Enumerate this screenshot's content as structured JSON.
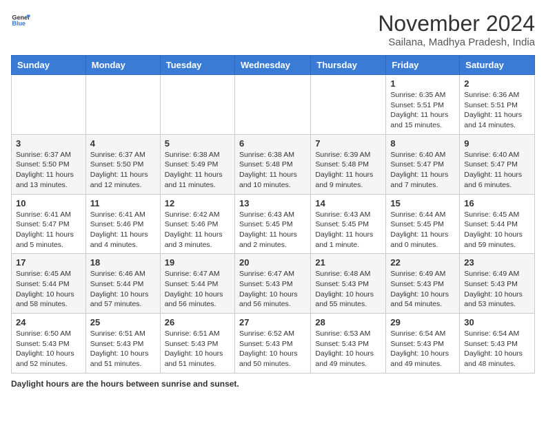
{
  "header": {
    "logo_general": "General",
    "logo_blue": "Blue",
    "month_title": "November 2024",
    "subtitle": "Sailana, Madhya Pradesh, India"
  },
  "days_of_week": [
    "Sunday",
    "Monday",
    "Tuesday",
    "Wednesday",
    "Thursday",
    "Friday",
    "Saturday"
  ],
  "weeks": [
    [
      {
        "day": "",
        "info": ""
      },
      {
        "day": "",
        "info": ""
      },
      {
        "day": "",
        "info": ""
      },
      {
        "day": "",
        "info": ""
      },
      {
        "day": "",
        "info": ""
      },
      {
        "day": "1",
        "info": "Sunrise: 6:35 AM\nSunset: 5:51 PM\nDaylight: 11 hours and 15 minutes."
      },
      {
        "day": "2",
        "info": "Sunrise: 6:36 AM\nSunset: 5:51 PM\nDaylight: 11 hours and 14 minutes."
      }
    ],
    [
      {
        "day": "3",
        "info": "Sunrise: 6:37 AM\nSunset: 5:50 PM\nDaylight: 11 hours and 13 minutes."
      },
      {
        "day": "4",
        "info": "Sunrise: 6:37 AM\nSunset: 5:50 PM\nDaylight: 11 hours and 12 minutes."
      },
      {
        "day": "5",
        "info": "Sunrise: 6:38 AM\nSunset: 5:49 PM\nDaylight: 11 hours and 11 minutes."
      },
      {
        "day": "6",
        "info": "Sunrise: 6:38 AM\nSunset: 5:48 PM\nDaylight: 11 hours and 10 minutes."
      },
      {
        "day": "7",
        "info": "Sunrise: 6:39 AM\nSunset: 5:48 PM\nDaylight: 11 hours and 9 minutes."
      },
      {
        "day": "8",
        "info": "Sunrise: 6:40 AM\nSunset: 5:47 PM\nDaylight: 11 hours and 7 minutes."
      },
      {
        "day": "9",
        "info": "Sunrise: 6:40 AM\nSunset: 5:47 PM\nDaylight: 11 hours and 6 minutes."
      }
    ],
    [
      {
        "day": "10",
        "info": "Sunrise: 6:41 AM\nSunset: 5:47 PM\nDaylight: 11 hours and 5 minutes."
      },
      {
        "day": "11",
        "info": "Sunrise: 6:41 AM\nSunset: 5:46 PM\nDaylight: 11 hours and 4 minutes."
      },
      {
        "day": "12",
        "info": "Sunrise: 6:42 AM\nSunset: 5:46 PM\nDaylight: 11 hours and 3 minutes."
      },
      {
        "day": "13",
        "info": "Sunrise: 6:43 AM\nSunset: 5:45 PM\nDaylight: 11 hours and 2 minutes."
      },
      {
        "day": "14",
        "info": "Sunrise: 6:43 AM\nSunset: 5:45 PM\nDaylight: 11 hours and 1 minute."
      },
      {
        "day": "15",
        "info": "Sunrise: 6:44 AM\nSunset: 5:45 PM\nDaylight: 11 hours and 0 minutes."
      },
      {
        "day": "16",
        "info": "Sunrise: 6:45 AM\nSunset: 5:44 PM\nDaylight: 10 hours and 59 minutes."
      }
    ],
    [
      {
        "day": "17",
        "info": "Sunrise: 6:45 AM\nSunset: 5:44 PM\nDaylight: 10 hours and 58 minutes."
      },
      {
        "day": "18",
        "info": "Sunrise: 6:46 AM\nSunset: 5:44 PM\nDaylight: 10 hours and 57 minutes."
      },
      {
        "day": "19",
        "info": "Sunrise: 6:47 AM\nSunset: 5:44 PM\nDaylight: 10 hours and 56 minutes."
      },
      {
        "day": "20",
        "info": "Sunrise: 6:47 AM\nSunset: 5:43 PM\nDaylight: 10 hours and 56 minutes."
      },
      {
        "day": "21",
        "info": "Sunrise: 6:48 AM\nSunset: 5:43 PM\nDaylight: 10 hours and 55 minutes."
      },
      {
        "day": "22",
        "info": "Sunrise: 6:49 AM\nSunset: 5:43 PM\nDaylight: 10 hours and 54 minutes."
      },
      {
        "day": "23",
        "info": "Sunrise: 6:49 AM\nSunset: 5:43 PM\nDaylight: 10 hours and 53 minutes."
      }
    ],
    [
      {
        "day": "24",
        "info": "Sunrise: 6:50 AM\nSunset: 5:43 PM\nDaylight: 10 hours and 52 minutes."
      },
      {
        "day": "25",
        "info": "Sunrise: 6:51 AM\nSunset: 5:43 PM\nDaylight: 10 hours and 51 minutes."
      },
      {
        "day": "26",
        "info": "Sunrise: 6:51 AM\nSunset: 5:43 PM\nDaylight: 10 hours and 51 minutes."
      },
      {
        "day": "27",
        "info": "Sunrise: 6:52 AM\nSunset: 5:43 PM\nDaylight: 10 hours and 50 minutes."
      },
      {
        "day": "28",
        "info": "Sunrise: 6:53 AM\nSunset: 5:43 PM\nDaylight: 10 hours and 49 minutes."
      },
      {
        "day": "29",
        "info": "Sunrise: 6:54 AM\nSunset: 5:43 PM\nDaylight: 10 hours and 49 minutes."
      },
      {
        "day": "30",
        "info": "Sunrise: 6:54 AM\nSunset: 5:43 PM\nDaylight: 10 hours and 48 minutes."
      }
    ]
  ],
  "footer": {
    "label": "Daylight hours",
    "note": "are the hours between sunrise and sunset."
  }
}
